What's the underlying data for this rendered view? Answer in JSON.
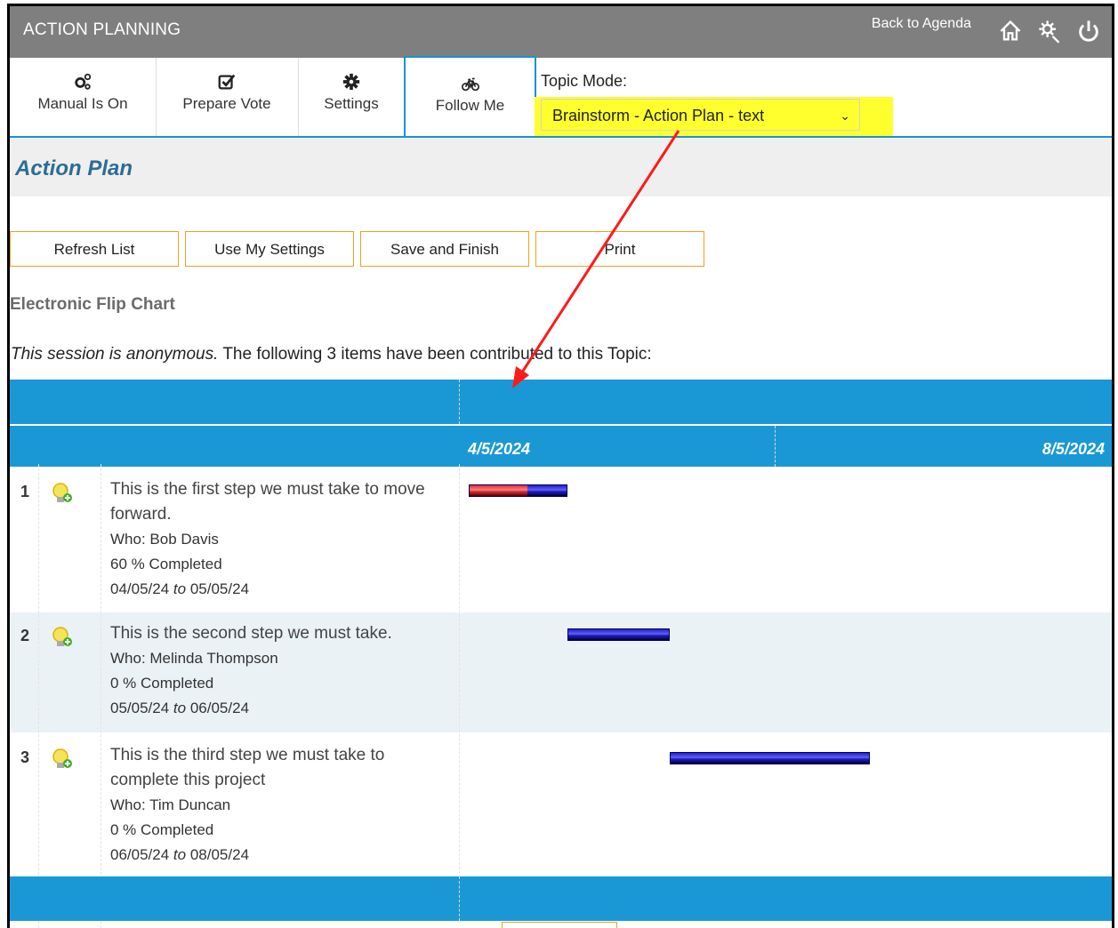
{
  "header": {
    "title": "ACTION PLANNING",
    "back_link": "Back to Agenda"
  },
  "toolbar": {
    "buttons": [
      {
        "label": "Manual Is On",
        "icon": "gears-icon"
      },
      {
        "label": "Prepare Vote",
        "icon": "checkbox-icon"
      },
      {
        "label": "Settings",
        "icon": "gear-icon"
      },
      {
        "label": "Follow Me",
        "icon": "bicycle-icon",
        "active": true
      }
    ],
    "topic_mode_label": "Topic Mode:",
    "topic_mode_value": "Brainstorm - Action Plan - text"
  },
  "section": {
    "heading": "Action Plan"
  },
  "actions": {
    "refresh": "Refresh List",
    "use_settings": "Use My Settings",
    "save": "Save and Finish",
    "print": "Print"
  },
  "subheading": "Electronic Flip Chart",
  "intro": {
    "italic": "This session is anonymous.",
    "rest": " The following 3 items have been contributed to this Topic:"
  },
  "gantt": {
    "start_label": "4/5/2024",
    "end_label": "8/5/2024"
  },
  "items": [
    {
      "num": "1",
      "text": "This is the first step we must take to move forward.",
      "who": "Who: Bob Davis",
      "completed": "60 % Completed",
      "from": "04/05/24",
      "to_word": "to",
      "until": "05/05/24",
      "pct": 60
    },
    {
      "num": "2",
      "text": "This is the second step we must take.",
      "who": "Who: Melinda Thompson",
      "completed": "0 % Completed",
      "from": "05/05/24",
      "to_word": "to",
      "until": "06/05/24",
      "pct": 0
    },
    {
      "num": "3",
      "text": "This is the third step we must take to complete this project",
      "who": "Who: Tim Duncan",
      "completed": "0 % Completed",
      "from": "06/05/24",
      "to_word": "to",
      "until": "08/05/24",
      "pct": 0
    }
  ],
  "colors": {
    "header": "#7f7f7f",
    "accent": "#1a98d5",
    "highlight": "#ffff2e",
    "progress": "#e3313a",
    "bar": "#2222cc"
  }
}
